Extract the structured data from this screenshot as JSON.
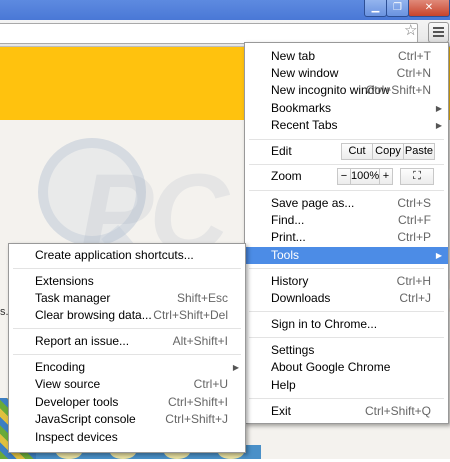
{
  "window": {
    "minimize_icon": "minimize-icon",
    "restore_icon": "restore-icon",
    "close_icon": "close-icon"
  },
  "toolbar": {
    "bookmark_icon": "star-icon",
    "menu_icon": "hamburger-menu-icon"
  },
  "page": {
    "banner_color": "#ffc20e",
    "partial_text": "s."
  },
  "chrome_menu": {
    "new_tab": {
      "label": "New tab",
      "shortcut": "Ctrl+T"
    },
    "new_window": {
      "label": "New window",
      "shortcut": "Ctrl+N"
    },
    "new_incognito": {
      "label": "New incognito window",
      "shortcut": "Ctrl+Shift+N"
    },
    "bookmarks": {
      "label": "Bookmarks"
    },
    "recent_tabs": {
      "label": "Recent Tabs"
    },
    "edit": {
      "label": "Edit",
      "cut": "Cut",
      "copy": "Copy",
      "paste": "Paste"
    },
    "zoom": {
      "label": "Zoom",
      "minus": "−",
      "value": "100%",
      "plus": "+"
    },
    "save_page": {
      "label": "Save page as...",
      "shortcut": "Ctrl+S"
    },
    "find": {
      "label": "Find...",
      "shortcut": "Ctrl+F"
    },
    "print": {
      "label": "Print...",
      "shortcut": "Ctrl+P"
    },
    "tools": {
      "label": "Tools"
    },
    "history": {
      "label": "History",
      "shortcut": "Ctrl+H"
    },
    "downloads": {
      "label": "Downloads",
      "shortcut": "Ctrl+J"
    },
    "sign_in": {
      "label": "Sign in to Chrome..."
    },
    "settings": {
      "label": "Settings"
    },
    "about": {
      "label": "About Google Chrome"
    },
    "help": {
      "label": "Help"
    },
    "exit": {
      "label": "Exit",
      "shortcut": "Ctrl+Shift+Q"
    }
  },
  "tools_menu": {
    "create_shortcuts": {
      "label": "Create application shortcuts..."
    },
    "extensions": {
      "label": "Extensions"
    },
    "task_manager": {
      "label": "Task manager",
      "shortcut": "Shift+Esc"
    },
    "clear_browsing": {
      "label": "Clear browsing data...",
      "shortcut": "Ctrl+Shift+Del"
    },
    "report_issue": {
      "label": "Report an issue...",
      "shortcut": "Alt+Shift+I"
    },
    "encoding": {
      "label": "Encoding"
    },
    "view_source": {
      "label": "View source",
      "shortcut": "Ctrl+U"
    },
    "dev_tools": {
      "label": "Developer tools",
      "shortcut": "Ctrl+Shift+I"
    },
    "js_console": {
      "label": "JavaScript console",
      "shortcut": "Ctrl+Shift+J"
    },
    "inspect_devices": {
      "label": "Inspect devices"
    }
  },
  "colors": {
    "highlight": "#4c8ce6"
  }
}
